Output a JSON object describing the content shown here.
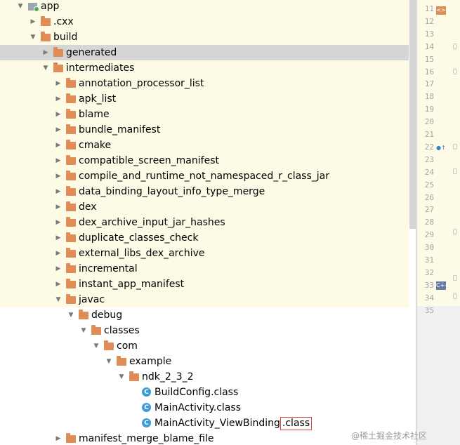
{
  "project_tree": {
    "rows": [
      {
        "label": "app",
        "icon": "module",
        "depth": 0,
        "expanded": true
      },
      {
        "label": ".cxx",
        "icon": "folder",
        "depth": 1,
        "expanded": false
      },
      {
        "label": "build",
        "icon": "folder",
        "depth": 1,
        "expanded": true
      },
      {
        "label": "generated",
        "icon": "folder",
        "depth": 2,
        "expanded": false,
        "selected": true
      },
      {
        "label": "intermediates",
        "icon": "folder",
        "depth": 2,
        "expanded": true
      },
      {
        "label": "annotation_processor_list",
        "icon": "folder",
        "depth": 3,
        "expanded": false
      },
      {
        "label": "apk_list",
        "icon": "folder",
        "depth": 3,
        "expanded": false
      },
      {
        "label": "blame",
        "icon": "folder",
        "depth": 3,
        "expanded": false
      },
      {
        "label": "bundle_manifest",
        "icon": "folder",
        "depth": 3,
        "expanded": false
      },
      {
        "label": "cmake",
        "icon": "folder",
        "depth": 3,
        "expanded": false
      },
      {
        "label": "compatible_screen_manifest",
        "icon": "folder",
        "depth": 3,
        "expanded": false
      },
      {
        "label": "compile_and_runtime_not_namespaced_r_class_jar",
        "icon": "folder",
        "depth": 3,
        "expanded": false
      },
      {
        "label": "data_binding_layout_info_type_merge",
        "icon": "folder",
        "depth": 3,
        "expanded": false
      },
      {
        "label": "dex",
        "icon": "folder",
        "depth": 3,
        "expanded": false
      },
      {
        "label": "dex_archive_input_jar_hashes",
        "icon": "folder",
        "depth": 3,
        "expanded": false
      },
      {
        "label": "duplicate_classes_check",
        "icon": "folder",
        "depth": 3,
        "expanded": false
      },
      {
        "label": "external_libs_dex_archive",
        "icon": "folder",
        "depth": 3,
        "expanded": false
      },
      {
        "label": "incremental",
        "icon": "folder",
        "depth": 3,
        "expanded": false
      },
      {
        "label": "instant_app_manifest",
        "icon": "folder",
        "depth": 3,
        "expanded": false
      },
      {
        "label": "javac",
        "icon": "folder",
        "depth": 3,
        "expanded": true
      },
      {
        "label": "debug",
        "icon": "folder",
        "depth": 4,
        "expanded": true
      },
      {
        "label": "classes",
        "icon": "folder",
        "depth": 5,
        "expanded": true
      },
      {
        "label": "com",
        "icon": "folder",
        "depth": 6,
        "expanded": true
      },
      {
        "label": "example",
        "icon": "folder",
        "depth": 7,
        "expanded": true
      },
      {
        "label": "ndk_2_3_2",
        "icon": "folder",
        "depth": 8,
        "expanded": true
      },
      {
        "label": "BuildConfig.class",
        "icon": "class",
        "depth": 9
      },
      {
        "label": "MainActivity.class",
        "icon": "class",
        "depth": 9
      },
      {
        "label": "MainActivity_ViewBinding",
        "ext": ".class",
        "icon": "class",
        "depth": 9
      },
      {
        "label": "manifest_merge_blame_file",
        "icon": "folder",
        "depth": 3,
        "expanded": false
      }
    ]
  },
  "gutter": {
    "line_numbers": [
      "11",
      "12",
      "13",
      "14",
      "15",
      "16",
      "17",
      "18",
      "19",
      "20",
      "21",
      "22",
      "23",
      "24",
      "25",
      "26",
      "27",
      "28",
      "29",
      "30",
      "31",
      "32",
      "33",
      "34",
      "35"
    ]
  },
  "colors": {
    "folder": "#e08c57",
    "selection": "#d5d5d5",
    "highlight": "#fdfbe6",
    "class_icon": "#3c9bd6",
    "ext_box": "#e04040"
  },
  "watermark": "@稀土掘金技术社区"
}
